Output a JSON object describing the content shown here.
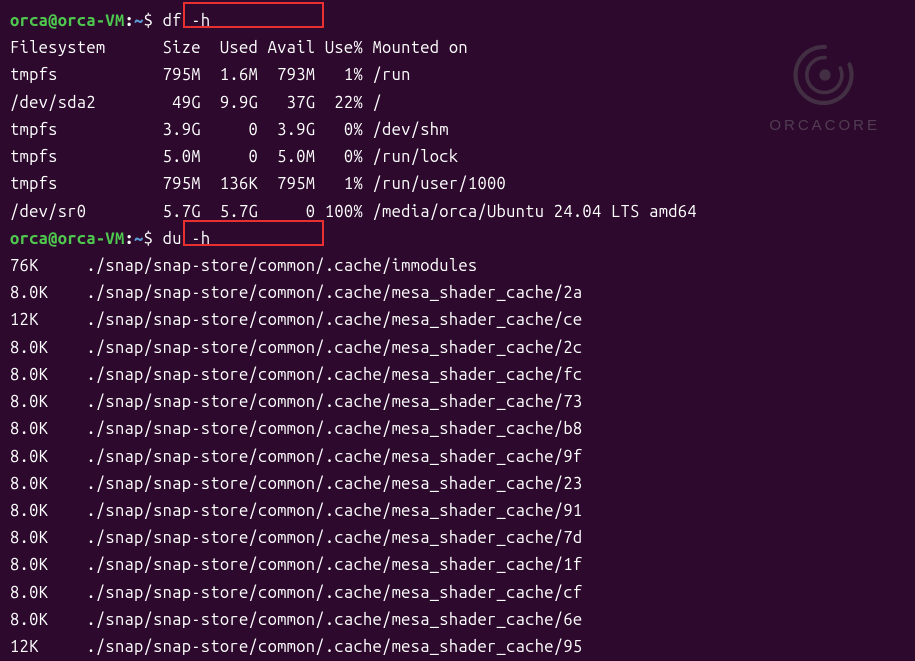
{
  "prompt": {
    "user": "orca@orca-VM",
    "sep": ":",
    "path": "~",
    "dollar": "$"
  },
  "commands": {
    "cmd1": "df -h",
    "cmd2": "du -h"
  },
  "df_header": "Filesystem      Size  Used Avail Use% Mounted on",
  "df_rows": [
    "tmpfs           795M  1.6M  793M   1% /run",
    "/dev/sda2        49G  9.9G   37G  22% /",
    "tmpfs           3.9G     0  3.9G   0% /dev/shm",
    "tmpfs           5.0M     0  5.0M   0% /run/lock",
    "tmpfs           795M  136K  795M   1% /run/user/1000",
    "/dev/sr0        5.7G  5.7G     0 100% /media/orca/Ubuntu 24.04 LTS amd64"
  ],
  "du_rows": [
    "76K     ./snap/snap-store/common/.cache/immodules",
    "8.0K    ./snap/snap-store/common/.cache/mesa_shader_cache/2a",
    "12K     ./snap/snap-store/common/.cache/mesa_shader_cache/ce",
    "8.0K    ./snap/snap-store/common/.cache/mesa_shader_cache/2c",
    "8.0K    ./snap/snap-store/common/.cache/mesa_shader_cache/fc",
    "8.0K    ./snap/snap-store/common/.cache/mesa_shader_cache/73",
    "8.0K    ./snap/snap-store/common/.cache/mesa_shader_cache/b8",
    "8.0K    ./snap/snap-store/common/.cache/mesa_shader_cache/9f",
    "8.0K    ./snap/snap-store/common/.cache/mesa_shader_cache/23",
    "8.0K    ./snap/snap-store/common/.cache/mesa_shader_cache/91",
    "8.0K    ./snap/snap-store/common/.cache/mesa_shader_cache/7d",
    "8.0K    ./snap/snap-store/common/.cache/mesa_shader_cache/1f",
    "8.0K    ./snap/snap-store/common/.cache/mesa_shader_cache/cf",
    "8.0K    ./snap/snap-store/common/.cache/mesa_shader_cache/6e",
    "12K     ./snap/snap-store/common/.cache/mesa_shader_cache/95"
  ],
  "watermark": {
    "text": "ORCACORE"
  }
}
